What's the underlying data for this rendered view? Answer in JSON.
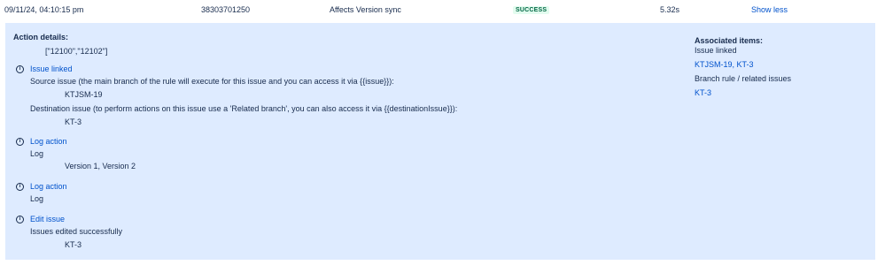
{
  "row": {
    "timestamp": "09/11/24, 04:10:15 pm",
    "id": "38303701250",
    "rule_name": "Affects Version sync",
    "status": "SUCCESS",
    "duration": "5.32s",
    "toggle_label": "Show less"
  },
  "details": {
    "heading": "Action details:",
    "ids_value": "[\"12100\",\"12102\"]",
    "actions": [
      {
        "title": "Issue linked",
        "lines": [
          {
            "label": "Source issue (the main branch of the rule will execute for this issue and you can access it via {{issue}}):",
            "value": "KTJSM-19"
          },
          {
            "label": "Destination issue (to perform actions on this issue use a 'Related branch', you can also access it via {{destinationIssue}}):",
            "value": "KT-3"
          }
        ]
      },
      {
        "title": "Log action",
        "label": "Log",
        "value": "Version 1, Version 2"
      },
      {
        "title": "Log action",
        "label": "Log"
      },
      {
        "title": "Edit issue",
        "label": "Issues edited successfully",
        "value": "KT-3"
      }
    ]
  },
  "associated": {
    "heading": "Associated items:",
    "group1_label": "Issue linked",
    "group1_links": "KTJSM-19, KT-3",
    "group2_label": "Branch rule / related issues",
    "group2_links": "KT-3"
  },
  "colors": {
    "panel_bg": "#deebff",
    "link": "#0052cc",
    "success_bg": "#e3fcef",
    "success_text": "#006644"
  },
  "icons": {
    "action_icon": "info-icon"
  }
}
